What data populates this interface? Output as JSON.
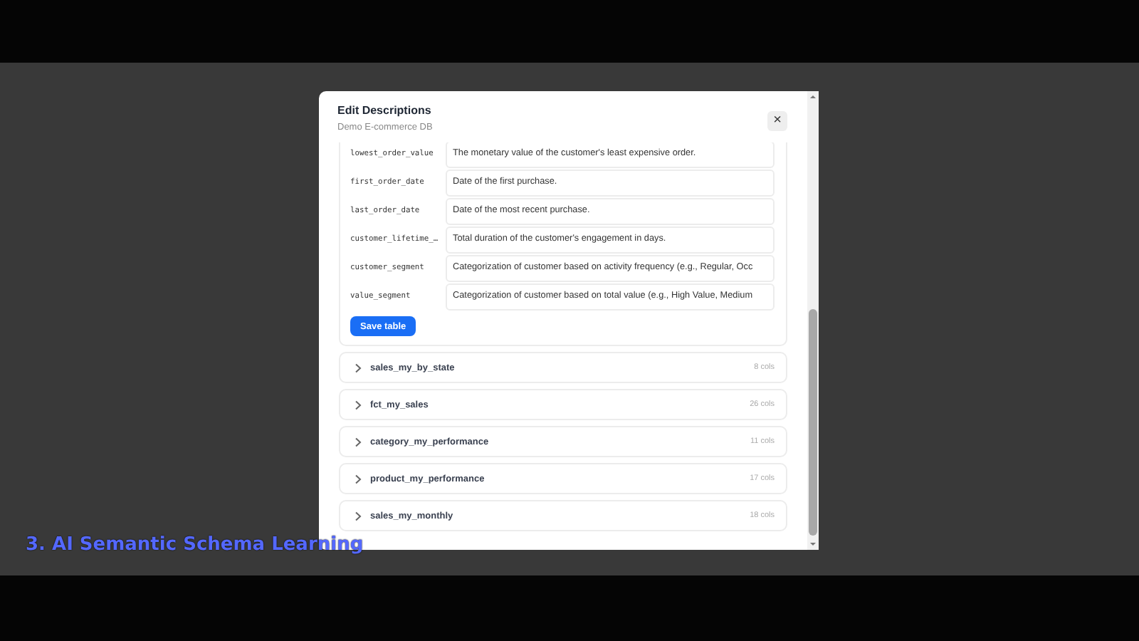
{
  "modal": {
    "title": "Edit Descriptions",
    "subtitle": "Demo E-commerce DB",
    "close_label": "×"
  },
  "expanded_table": {
    "columns": [
      {
        "name": "lowest_order_value",
        "description": "The monetary value of the customer's least expensive order."
      },
      {
        "name": "first_order_date",
        "description": "Date of the first purchase."
      },
      {
        "name": "last_order_date",
        "description": "Date of the most recent purchase."
      },
      {
        "name": "customer_lifetime_…",
        "description": "Total duration of the customer's engagement in days."
      },
      {
        "name": "customer_segment",
        "description": "Categorization of customer based on activity frequency (e.g., Regular, Occ"
      },
      {
        "name": "value_segment",
        "description": "Categorization of customer based on total value (e.g., High Value, Medium"
      }
    ],
    "save_label": "Save table"
  },
  "tables": [
    {
      "name": "sales_my_by_state",
      "count": "8 cols",
      "expanded": false
    },
    {
      "name": "fct_my_sales",
      "count": "26 cols",
      "expanded": false
    },
    {
      "name": "category_my_performance",
      "count": "11 cols",
      "expanded": false
    },
    {
      "name": "product_my_performance",
      "count": "17 cols",
      "expanded": false
    },
    {
      "name": "sales_my_monthly",
      "count": "18 cols",
      "expanded": false
    }
  ],
  "caption": "3. AI Semantic Schema Learning"
}
